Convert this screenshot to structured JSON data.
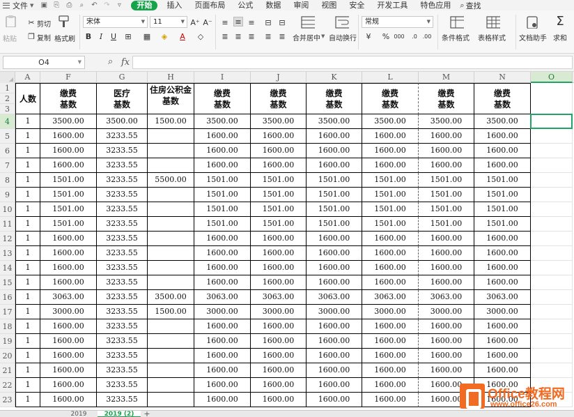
{
  "menubar": {
    "file": "文件",
    "tabs": [
      "开始",
      "插入",
      "页面布局",
      "公式",
      "数据",
      "审阅",
      "视图",
      "安全",
      "开发工具",
      "特色应用"
    ],
    "active_tab": "开始",
    "search": "查找",
    "accent": "#16a34a"
  },
  "ribbon": {
    "paste": "粘贴",
    "cut": "剪切",
    "copy": "复制",
    "format_painter": "格式刷",
    "font_name": "宋体",
    "font_size": "11",
    "merge_center": "合并居中",
    "wrap_text": "自动换行",
    "number_format": "常规",
    "conditional_format": "条件格式",
    "table_style": "表格样式",
    "doc_assistant": "文档助手",
    "sum": "求和"
  },
  "formulabar": {
    "namebox": "O4",
    "fx": "fx",
    "content": ""
  },
  "columns": [
    "A",
    "F",
    "G",
    "H",
    "I",
    "J",
    "K",
    "L",
    "M",
    "N",
    "O"
  ],
  "selected_column": "O",
  "selected_row": "4",
  "header_rows": [
    "1",
    "2",
    "3"
  ],
  "headers": {
    "A": "人数",
    "F": "缴费\n基数",
    "G": "医疗\n基数",
    "H": "住房公积金\n基数",
    "I": "缴费\n基数",
    "J": "缴费\n基数",
    "K": "缴费\n基数",
    "L": "缴费\n基数",
    "M": "缴费\n基数",
    "N": "缴费\n基数"
  },
  "rows": [
    {
      "n": "4",
      "cells": [
        "1",
        "3500.00",
        "3500.00",
        "1500.00",
        "3500.00",
        "3500.00",
        "3500.00",
        "3500.00",
        "3500.00",
        "3500.00"
      ]
    },
    {
      "n": "5",
      "cells": [
        "1",
        "1600.00",
        "3233.55",
        "",
        "1600.00",
        "1600.00",
        "1600.00",
        "1600.00",
        "1600.00",
        "1600.00"
      ]
    },
    {
      "n": "6",
      "cells": [
        "1",
        "1600.00",
        "3233.55",
        "",
        "1600.00",
        "1600.00",
        "1600.00",
        "1600.00",
        "1600.00",
        "1600.00"
      ]
    },
    {
      "n": "7",
      "cells": [
        "1",
        "1600.00",
        "3233.55",
        "",
        "1600.00",
        "1600.00",
        "1600.00",
        "1600.00",
        "1600.00",
        "1600.00"
      ]
    },
    {
      "n": "8",
      "cells": [
        "1",
        "1501.00",
        "3233.55",
        "5500.00",
        "1501.00",
        "1501.00",
        "1501.00",
        "1501.00",
        "1501.00",
        "1501.00"
      ]
    },
    {
      "n": "9",
      "cells": [
        "1",
        "1501.00",
        "3233.55",
        "",
        "1501.00",
        "1501.00",
        "1501.00",
        "1501.00",
        "1501.00",
        "1501.00"
      ]
    },
    {
      "n": "10",
      "cells": [
        "1",
        "1501.00",
        "3233.55",
        "",
        "1501.00",
        "1501.00",
        "1501.00",
        "1501.00",
        "1501.00",
        "1501.00"
      ]
    },
    {
      "n": "11",
      "cells": [
        "1",
        "1501.00",
        "3233.55",
        "",
        "1501.00",
        "1501.00",
        "1501.00",
        "1501.00",
        "1501.00",
        "1501.00"
      ]
    },
    {
      "n": "12",
      "cells": [
        "1",
        "1600.00",
        "3233.55",
        "",
        "1600.00",
        "1600.00",
        "1600.00",
        "1600.00",
        "1600.00",
        "1600.00"
      ]
    },
    {
      "n": "13",
      "cells": [
        "1",
        "1600.00",
        "3233.55",
        "",
        "1600.00",
        "1600.00",
        "1600.00",
        "1600.00",
        "1600.00",
        "1600.00"
      ]
    },
    {
      "n": "14",
      "cells": [
        "1",
        "1600.00",
        "3233.55",
        "",
        "1600.00",
        "1600.00",
        "1600.00",
        "1600.00",
        "1600.00",
        "1600.00"
      ]
    },
    {
      "n": "15",
      "cells": [
        "1",
        "1600.00",
        "3233.55",
        "",
        "1600.00",
        "1600.00",
        "1600.00",
        "1600.00",
        "1600.00",
        "1600.00"
      ]
    },
    {
      "n": "16",
      "cells": [
        "1",
        "3063.00",
        "3233.55",
        "3500.00",
        "3063.00",
        "3063.00",
        "3063.00",
        "3063.00",
        "3063.00",
        "3063.00"
      ]
    },
    {
      "n": "17",
      "cells": [
        "1",
        "3000.00",
        "3233.55",
        "1500.00",
        "3000.00",
        "3000.00",
        "3000.00",
        "3000.00",
        "3000.00",
        "3000.00"
      ]
    },
    {
      "n": "18",
      "cells": [
        "1",
        "1600.00",
        "3233.55",
        "",
        "1600.00",
        "1600.00",
        "1600.00",
        "1600.00",
        "1600.00",
        "1600.00"
      ]
    },
    {
      "n": "19",
      "cells": [
        "1",
        "1600.00",
        "3233.55",
        "",
        "1600.00",
        "1600.00",
        "1600.00",
        "1600.00",
        "1600.00",
        "1600.00"
      ]
    },
    {
      "n": "20",
      "cells": [
        "1",
        "1600.00",
        "3233.55",
        "",
        "1600.00",
        "1600.00",
        "1600.00",
        "1600.00",
        "1600.00",
        "1600.00"
      ]
    },
    {
      "n": "21",
      "cells": [
        "1",
        "1600.00",
        "3233.55",
        "",
        "1600.00",
        "1600.00",
        "1600.00",
        "1600.00",
        "1600.00",
        "1600.00"
      ]
    },
    {
      "n": "22",
      "cells": [
        "1",
        "1600.00",
        "3233.55",
        "",
        "1600.00",
        "1600.00",
        "1600.00",
        "1600.00",
        "1600.00",
        "1600.00"
      ]
    },
    {
      "n": "23",
      "cells": [
        "1",
        "1600.00",
        "3233.55",
        "",
        "1600.00",
        "1600.00",
        "1600.00",
        "1600.00",
        "1600.00",
        "1600.00"
      ]
    }
  ],
  "sheets": [
    "2019",
    "2019 (2)"
  ],
  "active_sheet": "2019 (2)",
  "add_sheet": "+",
  "watermark": {
    "title": "Office教程网",
    "url": "www.office26.com",
    "color": "#f26b22"
  }
}
